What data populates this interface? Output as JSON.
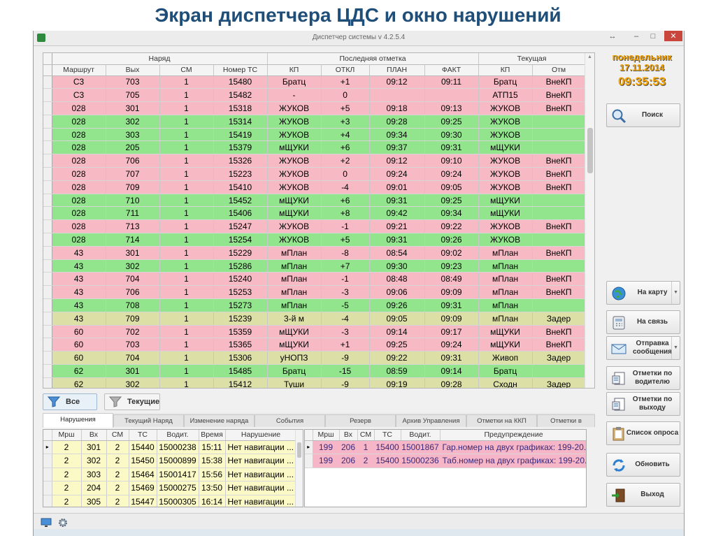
{
  "slide_title": "Экран диспетчера ЦДС и окно нарушений",
  "window": {
    "title": "Диспетчер системы v 4.2.5.4",
    "buttons": {
      "restore": "↔",
      "minimize": "–",
      "maximize": "□",
      "close": "✕"
    }
  },
  "main_grid": {
    "group_headers": [
      "Наряд",
      "Последняя отметка",
      "Текущая"
    ],
    "columns": [
      "Маршрут",
      "Вых",
      "СМ",
      "Номер ТС",
      "КП",
      "ОТКЛ",
      "ПЛАН",
      "ФАКТ",
      "КП",
      "Отм"
    ],
    "rows": [
      {
        "color": "pink",
        "cells": [
          "С3",
          "703",
          "1",
          "15480",
          "Братц",
          "+1",
          "09:12",
          "09:11",
          "Братц",
          "ВнеКП"
        ]
      },
      {
        "color": "pink",
        "cells": [
          "С3",
          "705",
          "1",
          "15482",
          "-",
          "0",
          "",
          "",
          "АТП15",
          "ВнеКП"
        ]
      },
      {
        "color": "pink",
        "cells": [
          "028",
          "301",
          "1",
          "15318",
          "ЖУКОВ",
          "+5",
          "09:18",
          "09:13",
          "ЖУКОВ",
          "ВнеКП"
        ]
      },
      {
        "color": "green",
        "cells": [
          "028",
          "302",
          "1",
          "15314",
          "ЖУКОВ",
          "+3",
          "09:28",
          "09:25",
          "ЖУКОВ",
          ""
        ]
      },
      {
        "color": "green",
        "cells": [
          "028",
          "303",
          "1",
          "15419",
          "ЖУКОВ",
          "+4",
          "09:34",
          "09:30",
          "ЖУКОВ",
          ""
        ]
      },
      {
        "color": "green",
        "cells": [
          "028",
          "205",
          "1",
          "15379",
          "мЩУКИ",
          "+6",
          "09:37",
          "09:31",
          "мЩУКИ",
          ""
        ]
      },
      {
        "color": "pink",
        "cells": [
          "028",
          "706",
          "1",
          "15326",
          "ЖУКОВ",
          "+2",
          "09:12",
          "09:10",
          "ЖУКОВ",
          "ВнеКП"
        ]
      },
      {
        "color": "pink",
        "cells": [
          "028",
          "707",
          "1",
          "15223",
          "ЖУКОВ",
          "0",
          "09:24",
          "09:24",
          "ЖУКОВ",
          "ВнеКП"
        ]
      },
      {
        "color": "pink",
        "cells": [
          "028",
          "709",
          "1",
          "15410",
          "ЖУКОВ",
          "-4",
          "09:01",
          "09:05",
          "ЖУКОВ",
          "ВнеКП"
        ]
      },
      {
        "color": "green",
        "cells": [
          "028",
          "710",
          "1",
          "15452",
          "мЩУКИ",
          "+6",
          "09:31",
          "09:25",
          "мЩУКИ",
          ""
        ]
      },
      {
        "color": "green",
        "cells": [
          "028",
          "711",
          "1",
          "15406",
          "мЩУКИ",
          "+8",
          "09:42",
          "09:34",
          "мЩУКИ",
          ""
        ]
      },
      {
        "color": "pink",
        "cells": [
          "028",
          "713",
          "1",
          "15247",
          "ЖУКОВ",
          "-1",
          "09:21",
          "09:22",
          "ЖУКОВ",
          "ВнеКП"
        ]
      },
      {
        "color": "green",
        "cells": [
          "028",
          "714",
          "1",
          "15254",
          "ЖУКОВ",
          "+5",
          "09:31",
          "09:26",
          "ЖУКОВ",
          ""
        ]
      },
      {
        "color": "pink",
        "cells": [
          "43",
          "301",
          "1",
          "15229",
          "мПлан",
          "-8",
          "08:54",
          "09:02",
          "мПлан",
          "ВнеКП"
        ]
      },
      {
        "color": "green",
        "cells": [
          "43",
          "302",
          "1",
          "15286",
          "мПлан",
          "+7",
          "09:30",
          "09:23",
          "мПлан",
          ""
        ]
      },
      {
        "color": "pink",
        "cells": [
          "43",
          "704",
          "1",
          "15240",
          "мПлан",
          "-1",
          "08:48",
          "08:49",
          "мПлан",
          "ВнеКП"
        ]
      },
      {
        "color": "pink",
        "cells": [
          "43",
          "706",
          "1",
          "15253",
          "мПлан",
          "-3",
          "09:06",
          "09:09",
          "мПлан",
          "ВнеКП"
        ]
      },
      {
        "color": "green",
        "cells": [
          "43",
          "708",
          "1",
          "15273",
          "мПлан",
          "-5",
          "09:26",
          "09:31",
          "мПлан",
          ""
        ]
      },
      {
        "color": "khaki",
        "cells": [
          "43",
          "709",
          "1",
          "15239",
          "3-й м",
          "-4",
          "09:05",
          "09:09",
          "мПлан",
          "Задер"
        ]
      },
      {
        "color": "pink",
        "cells": [
          "60",
          "702",
          "1",
          "15359",
          "мЩУКИ",
          "-3",
          "09:14",
          "09:17",
          "мЩУКИ",
          "ВнеКП"
        ]
      },
      {
        "color": "pink",
        "cells": [
          "60",
          "703",
          "1",
          "15365",
          "мЩУКИ",
          "+1",
          "09:25",
          "09:24",
          "мЩУКИ",
          "ВнеКП"
        ]
      },
      {
        "color": "khaki",
        "cells": [
          "60",
          "704",
          "1",
          "15306",
          "уНОПЗ",
          "-9",
          "09:22",
          "09:31",
          "Живоп",
          "Задер"
        ]
      },
      {
        "color": "green",
        "cells": [
          "62",
          "301",
          "1",
          "15485",
          "Братц",
          "-15",
          "08:59",
          "09:14",
          "Братц",
          ""
        ]
      },
      {
        "color": "khaki",
        "cells": [
          "62",
          "302",
          "1",
          "15412",
          "Туши",
          "-9",
          "09:19",
          "09:28",
          "Сходн",
          "Задер"
        ]
      }
    ]
  },
  "filters": {
    "all": "Все",
    "current": "Текущие"
  },
  "tabs": [
    "Нарушения",
    "Текущий Наряд",
    "Изменение наряда",
    "События",
    "Резерв",
    "Архив Управления",
    "Отметки на ККП",
    "Отметки в"
  ],
  "violations": {
    "columns": [
      "Мрш",
      "Вх",
      "СМ",
      "ТС",
      "Водит.",
      "Время",
      "Нарушение"
    ],
    "rows": [
      [
        "2",
        "301",
        "2",
        "15440",
        "15000238",
        "15:11",
        "Нет навигации ..."
      ],
      [
        "2",
        "302",
        "2",
        "15450",
        "15000899",
        "15:38",
        "Нет навигации ..."
      ],
      [
        "2",
        "303",
        "2",
        "15464",
        "15001417",
        "15:56",
        "Нет навигации ..."
      ],
      [
        "2",
        "204",
        "2",
        "15469",
        "15000275",
        "13:50",
        "Нет навигации ..."
      ],
      [
        "2",
        "305",
        "2",
        "15447",
        "15000305",
        "16:14",
        "Нет навигации ..."
      ]
    ]
  },
  "warnings": {
    "columns": [
      "Мрш",
      "Вх",
      "СМ",
      "ТС",
      "Водит.",
      "Предупреждение"
    ],
    "rows": [
      [
        "199",
        "206",
        "1",
        "15400",
        "15001867",
        "Гар.номер на двух графиках: 199-20..."
      ],
      [
        "199",
        "206",
        "2",
        "15400",
        "15000236",
        "Таб.номер на двух графиках: 199-20..."
      ]
    ]
  },
  "clock": {
    "day": "понедельник",
    "date": "17.11.2014",
    "time": "09:35:53"
  },
  "side_buttons": {
    "search": "Поиск",
    "map": "На карту",
    "contact": "На связь",
    "send": "Отправка сообщения",
    "by_driver": "Отметки по водителю",
    "by_exit": "Отметки по выходу",
    "poll": "Список опроса",
    "refresh": "Обновить",
    "exit": "Выход"
  },
  "colors": {
    "pink": "#f7b9c3",
    "green": "#92e58c",
    "khaki": "#dde0a6",
    "clock": "#f2a100",
    "title": "#1f4e79"
  }
}
